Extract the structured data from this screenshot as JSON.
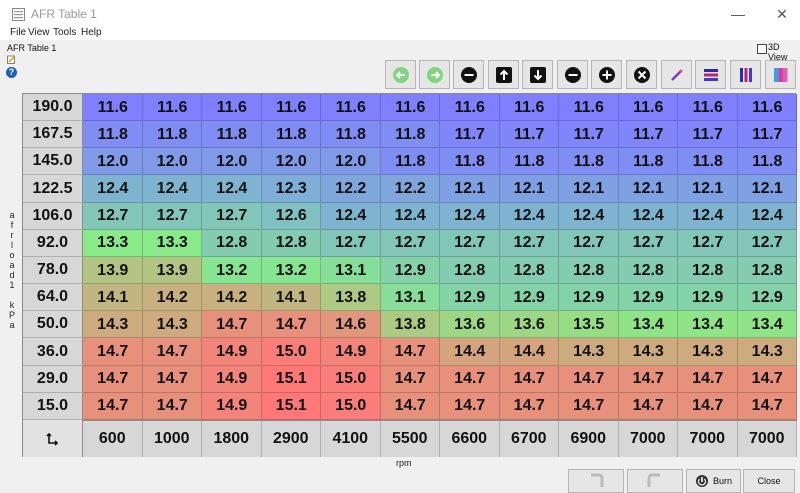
{
  "window": {
    "title": "AFR Table 1",
    "minimize_glyph": "—",
    "close_glyph": "✕"
  },
  "menu": {
    "items": [
      "File",
      "View",
      "Tools",
      "Help"
    ]
  },
  "table": {
    "label": "AFR Table 1",
    "view3d_label": "3D View",
    "y_axis_label": "afrload1 kPa",
    "y_axis_label_chars": [
      "a",
      "f",
      "r",
      "l",
      "o",
      "a",
      "d",
      "1",
      " ",
      "k",
      "P",
      "a"
    ],
    "x_axis_label": "rpm",
    "corner_icon": "swap-axes-icon",
    "y_values": [
      "190.0",
      "167.5",
      "145.0",
      "122.5",
      "106.0",
      "92.0",
      "78.0",
      "64.0",
      "50.0",
      "36.0",
      "29.0",
      "15.0"
    ],
    "x_values": [
      "600",
      "1000",
      "1800",
      "2900",
      "4100",
      "5500",
      "6600",
      "6700",
      "6900",
      "7000",
      "7000",
      "7000"
    ],
    "rows": [
      [
        "11.6",
        "11.6",
        "11.6",
        "11.6",
        "11.6",
        "11.6",
        "11.6",
        "11.6",
        "11.6",
        "11.6",
        "11.6",
        "11.6"
      ],
      [
        "11.8",
        "11.8",
        "11.8",
        "11.8",
        "11.8",
        "11.8",
        "11.7",
        "11.7",
        "11.7",
        "11.7",
        "11.7",
        "11.7"
      ],
      [
        "12.0",
        "12.0",
        "12.0",
        "12.0",
        "12.0",
        "11.8",
        "11.8",
        "11.8",
        "11.8",
        "11.8",
        "11.8",
        "11.8"
      ],
      [
        "12.4",
        "12.4",
        "12.4",
        "12.3",
        "12.2",
        "12.2",
        "12.1",
        "12.1",
        "12.1",
        "12.1",
        "12.1",
        "12.1"
      ],
      [
        "12.7",
        "12.7",
        "12.7",
        "12.6",
        "12.4",
        "12.4",
        "12.4",
        "12.4",
        "12.4",
        "12.4",
        "12.4",
        "12.4"
      ],
      [
        "13.3",
        "13.3",
        "12.8",
        "12.8",
        "12.7",
        "12.7",
        "12.7",
        "12.7",
        "12.7",
        "12.7",
        "12.7",
        "12.7"
      ],
      [
        "13.9",
        "13.9",
        "13.2",
        "13.2",
        "13.1",
        "12.9",
        "12.8",
        "12.8",
        "12.8",
        "12.8",
        "12.8",
        "12.8"
      ],
      [
        "14.1",
        "14.2",
        "14.2",
        "14.1",
        "13.8",
        "13.1",
        "12.9",
        "12.9",
        "12.9",
        "12.9",
        "12.9",
        "12.9"
      ],
      [
        "14.3",
        "14.3",
        "14.7",
        "14.7",
        "14.6",
        "13.8",
        "13.6",
        "13.6",
        "13.5",
        "13.4",
        "13.4",
        "13.4"
      ],
      [
        "14.7",
        "14.7",
        "14.9",
        "15.0",
        "14.9",
        "14.7",
        "14.4",
        "14.4",
        "14.3",
        "14.3",
        "14.3",
        "14.3"
      ],
      [
        "14.7",
        "14.7",
        "14.9",
        "15.1",
        "15.0",
        "14.7",
        "14.7",
        "14.7",
        "14.7",
        "14.7",
        "14.7",
        "14.7"
      ],
      [
        "14.7",
        "14.7",
        "14.9",
        "15.1",
        "15.0",
        "14.7",
        "14.7",
        "14.7",
        "14.7",
        "14.7",
        "14.7",
        "14.7"
      ]
    ]
  },
  "toolbar": {
    "buttons": [
      {
        "name": "rotate-left-button",
        "icon": "rotate-left-icon"
      },
      {
        "name": "rotate-right-button",
        "icon": "rotate-right-icon"
      },
      {
        "name": "decrement-button",
        "icon": "minus-circle-icon"
      },
      {
        "name": "shift-up-button",
        "icon": "arrow-up-icon"
      },
      {
        "name": "shift-down-button",
        "icon": "arrow-down-icon"
      },
      {
        "name": "decrement-small-button",
        "icon": "minus-circle-icon"
      },
      {
        "name": "increment-button",
        "icon": "plus-circle-icon"
      },
      {
        "name": "clear-button",
        "icon": "x-circle-icon"
      },
      {
        "name": "edit-button",
        "icon": "pencil-icon"
      },
      {
        "name": "horizontal-interpolate-button",
        "icon": "horizontal-bars-icon"
      },
      {
        "name": "vertical-interpolate-button",
        "icon": "vertical-bars-icon"
      },
      {
        "name": "interpolate-all-button",
        "icon": "gradient-icon"
      }
    ]
  },
  "footer": {
    "undo_icon": "undo-icon",
    "redo_icon": "redo-icon",
    "burn_label": "Burn",
    "close_label": "Close"
  },
  "colors": {
    "rich": "#8080ff",
    "mid": "#88e888",
    "lean": "#ff7878",
    "toolbar_green": "#7fd67f",
    "burn_icon": "#333333"
  }
}
